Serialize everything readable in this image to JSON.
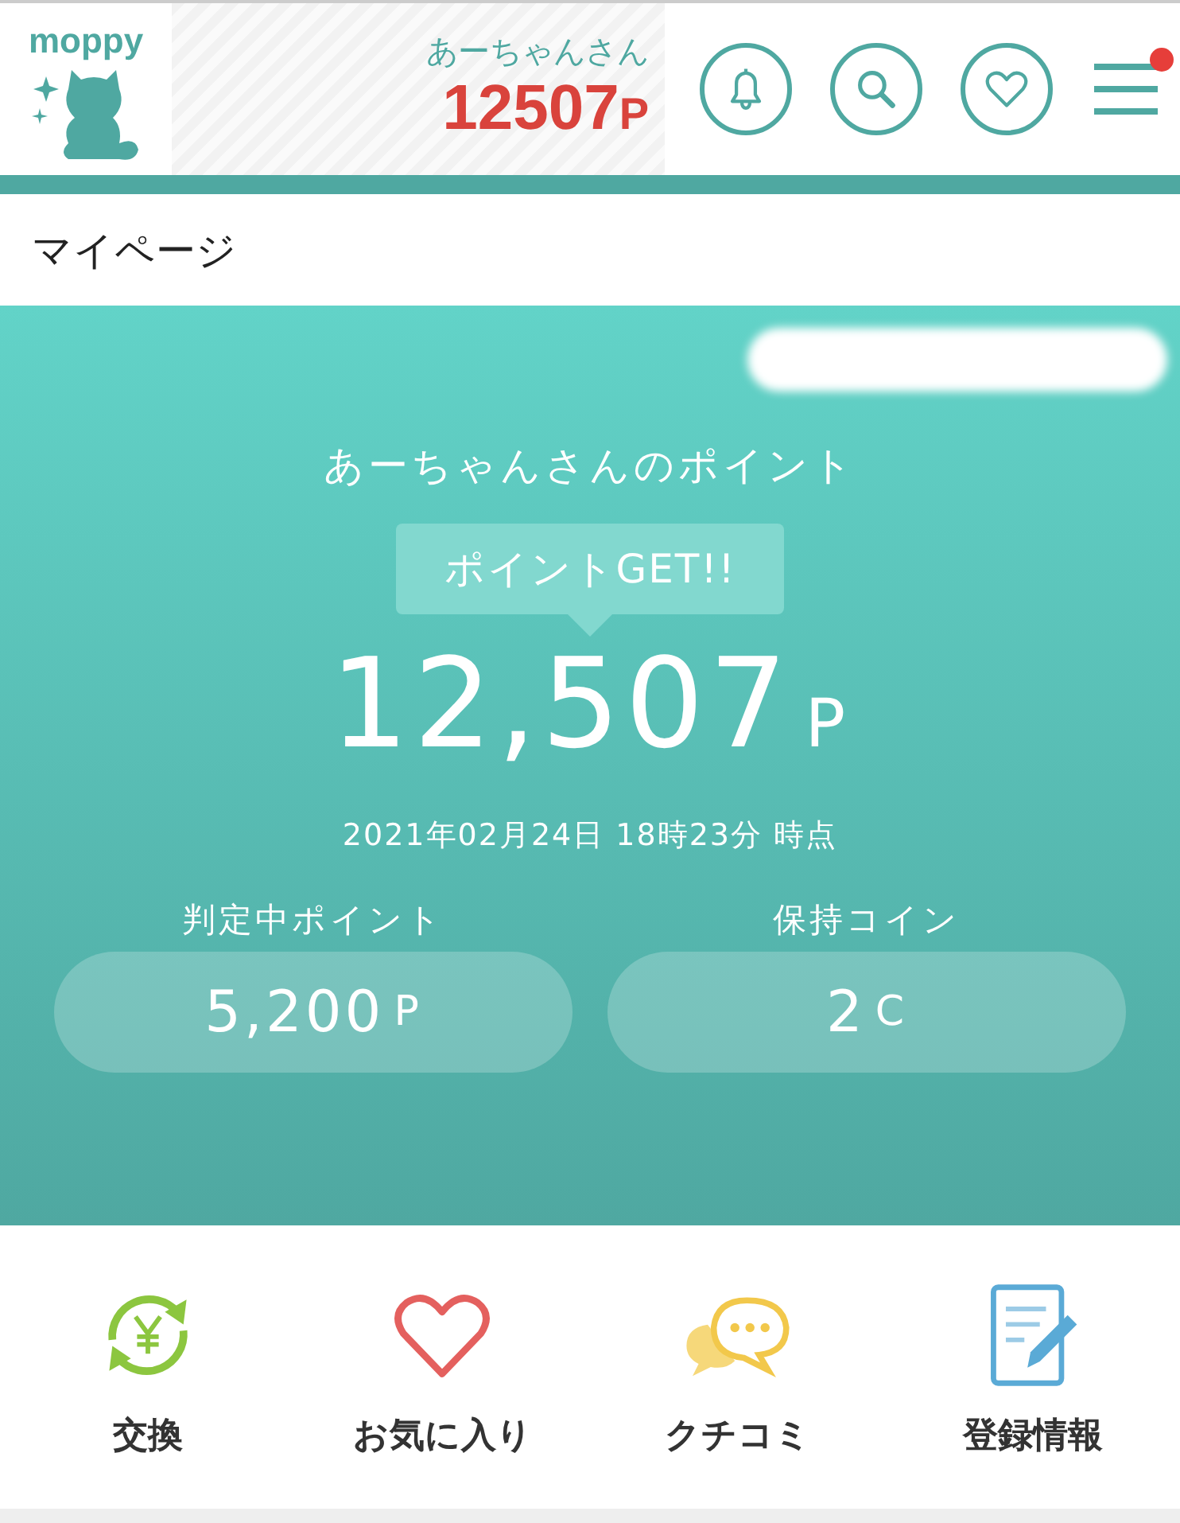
{
  "header": {
    "logo": "moppy",
    "user_name": "あーちゃんさん",
    "points": "12507",
    "points_unit": "P",
    "menu_badge": true
  },
  "page_title": "マイページ",
  "summary": {
    "heading": "あーちゃんさんのポイント",
    "get_button": "ポイントGET!!",
    "points": "12,507",
    "points_unit": "P",
    "as_of": "2021年02月24日 18時23分 時点",
    "stats": [
      {
        "label": "判定中ポイント",
        "value": "5,200",
        "unit": "P"
      },
      {
        "label": "保持コイン",
        "value": "2",
        "unit": "C"
      }
    ]
  },
  "shortcuts": [
    {
      "kind": "exchange",
      "label": "交換"
    },
    {
      "kind": "favorite",
      "label": "お気に入り"
    },
    {
      "kind": "review",
      "label": "クチコミ"
    },
    {
      "kind": "profile",
      "label": "登録情報"
    }
  ]
}
